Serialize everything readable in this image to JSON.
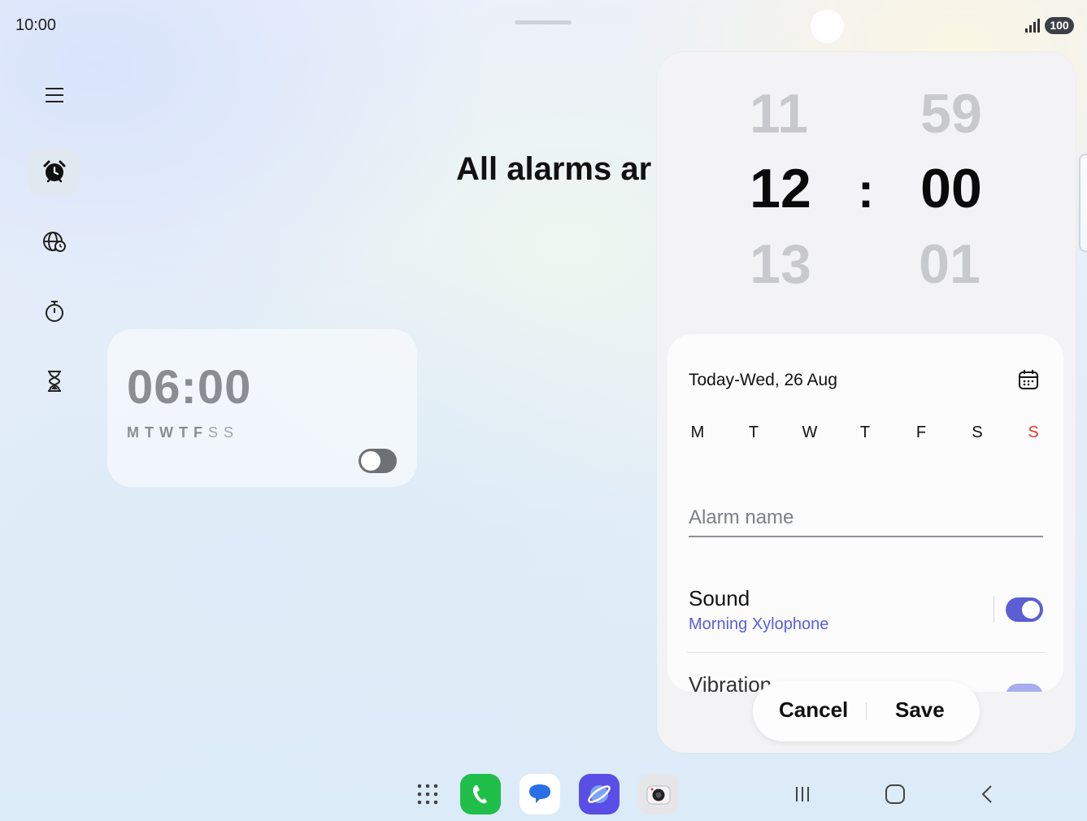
{
  "status_bar": {
    "time": "10:00",
    "battery": "100"
  },
  "main": {
    "heading": "All alarms ar"
  },
  "rail": {
    "items": [
      {
        "name": "menu",
        "icon": "menu-icon"
      },
      {
        "name": "alarm",
        "icon": "alarm-clock-icon",
        "active": true
      },
      {
        "name": "world-clock",
        "icon": "globe-clock-icon"
      },
      {
        "name": "stopwatch",
        "icon": "stopwatch-icon"
      },
      {
        "name": "timer",
        "icon": "hourglass-icon"
      }
    ]
  },
  "alarm_card": {
    "time": "06:00",
    "days": [
      "M",
      "T",
      "W",
      "T",
      "F",
      "S",
      "S"
    ],
    "enabled": false
  },
  "editor": {
    "picker": {
      "hour_above": "11",
      "hour_selected": "12",
      "hour_below": "13",
      "separator": ":",
      "minute_above": "59",
      "minute_selected": "00",
      "minute_below": "01"
    },
    "date_text": "Today-Wed, 26 Aug",
    "weekdays": [
      "M",
      "T",
      "W",
      "T",
      "F",
      "S",
      "S"
    ],
    "alarm_name_placeholder": "Alarm name",
    "alarm_name_value": "",
    "sound": {
      "title": "Sound",
      "value": "Morning Xylophone",
      "enabled": true
    },
    "vibration": {
      "title": "Vibration",
      "enabled": true
    },
    "cancel_label": "Cancel",
    "save_label": "Save"
  },
  "taskbar": {
    "apps": [
      {
        "name": "apps-grid-icon"
      },
      {
        "name": "phone-app-icon",
        "color": "#1fbf4a"
      },
      {
        "name": "messages-app-icon",
        "color": "#2a6fe8"
      },
      {
        "name": "internet-app-icon",
        "color": "#5b4ee6"
      },
      {
        "name": "camera-app-icon",
        "color": "#e6e6e8"
      }
    ],
    "nav": [
      "recents-icon",
      "home-icon",
      "back-icon"
    ]
  },
  "colors": {
    "accent": "#5a5fd6",
    "sunday": "#e13b30"
  }
}
